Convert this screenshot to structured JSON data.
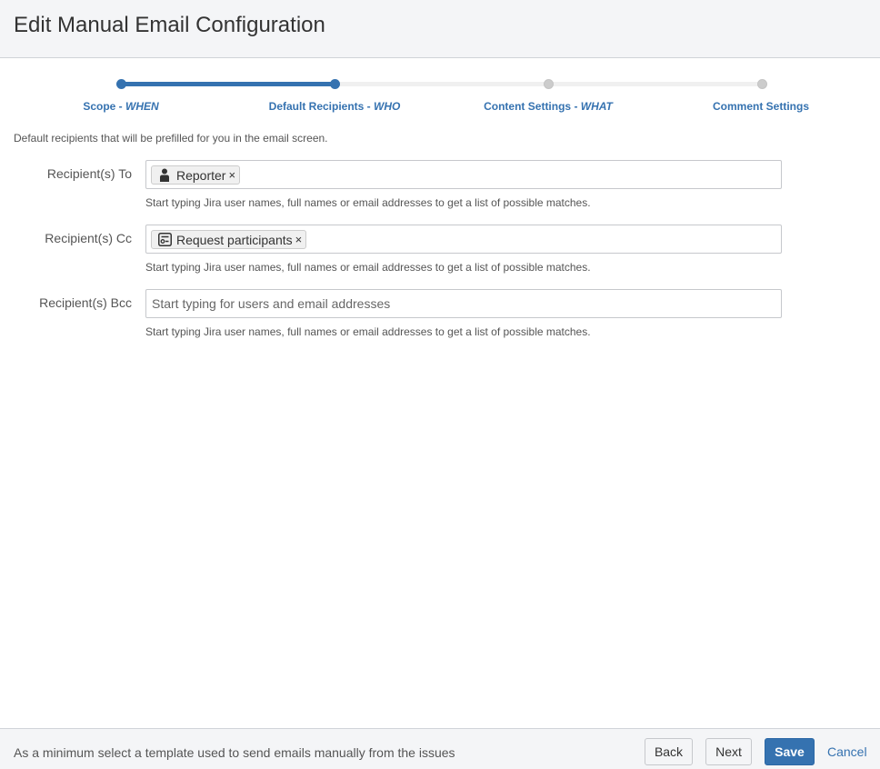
{
  "header": {
    "title": "Edit Manual Email Configuration"
  },
  "wizard": {
    "steps": [
      {
        "label": "Scope - ",
        "emphasis": "WHEN",
        "state": "complete"
      },
      {
        "label": "Default Recipients - ",
        "emphasis": "WHO",
        "state": "current"
      },
      {
        "label": "Content Settings - ",
        "emphasis": "WHAT",
        "state": "pending"
      },
      {
        "label": "Comment Settings",
        "emphasis": "",
        "state": "pending"
      }
    ]
  },
  "description": "Default recipients that will be prefilled for you in the email screen.",
  "fields": {
    "to": {
      "label": "Recipient(s) To",
      "chip_text": "Reporter",
      "chip_icon": "user-icon",
      "hint": "Start typing Jira user names, full names or email addresses to get a list of possible matches."
    },
    "cc": {
      "label": "Recipient(s) Cc",
      "chip_text": "Request participants",
      "chip_icon": "participants-icon",
      "hint": "Start typing Jira user names, full names or email addresses to get a list of possible matches."
    },
    "bcc": {
      "label": "Recipient(s) Bcc",
      "placeholder": "Start typing for users and email addresses",
      "hint": "Start typing Jira user names, full names or email addresses to get a list of possible matches."
    }
  },
  "chip_remove_glyph": "×",
  "footer": {
    "message": "As a minimum select a template used to send emails manually from the issues",
    "back_label": "Back",
    "next_label": "Next",
    "save_label": "Save",
    "cancel_label": "Cancel"
  },
  "colors": {
    "accent": "#3572b0",
    "pending_dot": "#cccccc",
    "header_bg": "#f4f5f7"
  }
}
